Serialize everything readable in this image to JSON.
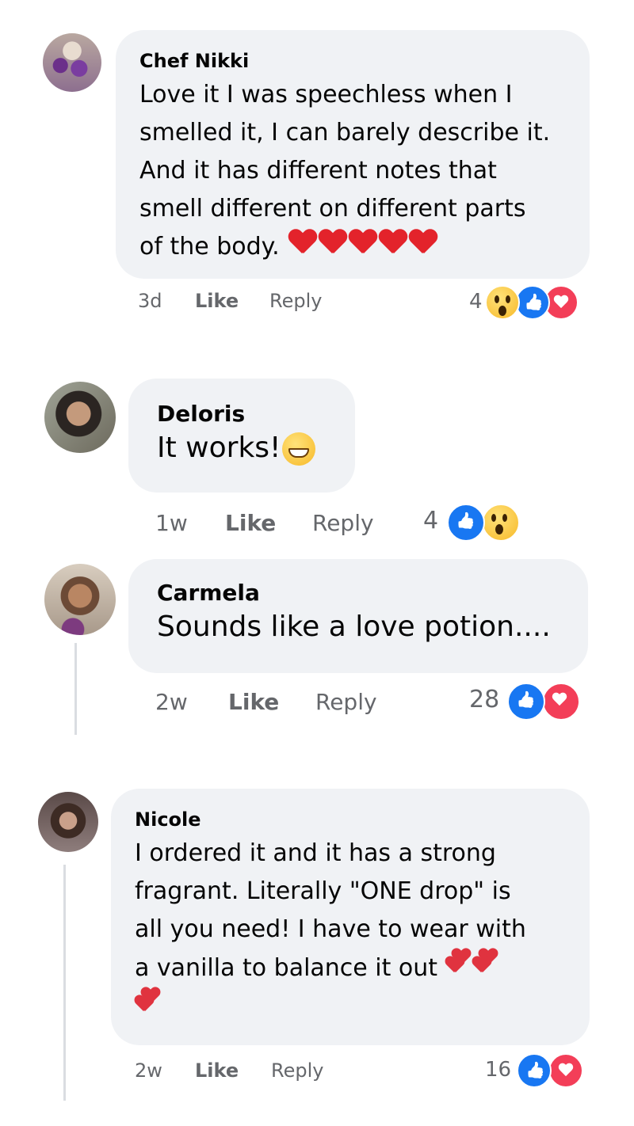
{
  "comments": [
    {
      "author": "Chef Nikki",
      "text": "Love it I was speechless when I\nsmelled it, I can barely describe it.\nAnd it has different notes that\nsmell different on different parts\nof the body. ",
      "emoji": "heart-emoji x5",
      "time": "3d",
      "like_label": "Like",
      "reply_label": "Reply",
      "reaction_count": "4",
      "reactions": [
        "wow-icon",
        "like-icon",
        "love-icon"
      ]
    },
    {
      "author": "Deloris",
      "text": "It works!",
      "emoji": "grinning-face-emoji",
      "time": "1w",
      "like_label": "Like",
      "reply_label": "Reply",
      "reaction_count": "4",
      "reactions": [
        "like-icon",
        "wow-icon"
      ]
    },
    {
      "author": "Carmela",
      "text": "Sounds like a love potion....",
      "time": "2w",
      "like_label": "Like",
      "reply_label": "Reply",
      "reaction_count": "28",
      "reactions": [
        "like-icon",
        "love-icon"
      ]
    },
    {
      "author": "Nicole",
      "text": "I ordered it and it has a strong\nfragrant. Literally \"ONE drop\" is\nall you need! I have to wear with\na vanilla to balance it out ",
      "emoji": "two-hearts-emoji x3",
      "time": "2w",
      "like_label": "Like",
      "reply_label": "Reply",
      "reaction_count": "16",
      "reactions": [
        "like-icon",
        "love-icon"
      ]
    }
  ],
  "colors": {
    "bubble": "#f0f2f5",
    "meta_text": "#65676b",
    "like_blue": "#1877f2",
    "love_red": "#f33e58",
    "wow_yellow": "#f7b928"
  }
}
